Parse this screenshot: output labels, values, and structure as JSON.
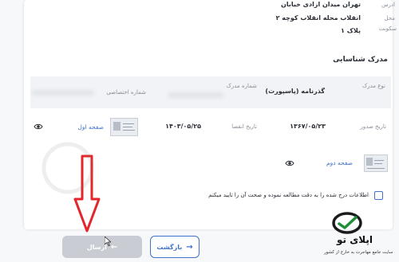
{
  "address": {
    "label_address": "ادرس",
    "value_address": "تهران میدان ازادی خیابان",
    "label_area": "محل",
    "value_area": "انقلاب محله انقلاب کوچه ۲",
    "label_residence": "سکونت",
    "value_plate": "پلاک ۱"
  },
  "documents": {
    "title": "مدرک شناسایی",
    "headers": {
      "type": "نوع مدرک",
      "number": "شماره مدرک",
      "special": "شماره اختصاصی"
    },
    "type_value": "گذرنامه (پاسپورت)",
    "issue_label": "تاریخ صدور",
    "issue_value": "۱۳۶۷/۰۵/۲۳",
    "expiry_label": "تاریخ انقضا",
    "expiry_value": "۱۴۰۳/۰۵/۲۵",
    "first_page": "صفحه اول",
    "second_page": "صفحه دوم"
  },
  "confirm_text": "اطلاعات درج شده را به دقت مطالعه نموده و صحت آن را تایید میکنم",
  "buttons": {
    "send": "ارسال",
    "back": "بازگشت"
  },
  "brand": {
    "name": "اپلای تو",
    "tagline": "سایت جامع مهاجرت به خارج از کشور",
    "accent": "#1f8f3a"
  },
  "colors": {
    "link": "#3f72c8",
    "arrow": "#e3262b",
    "send_disabled": "#c9cdd3"
  }
}
